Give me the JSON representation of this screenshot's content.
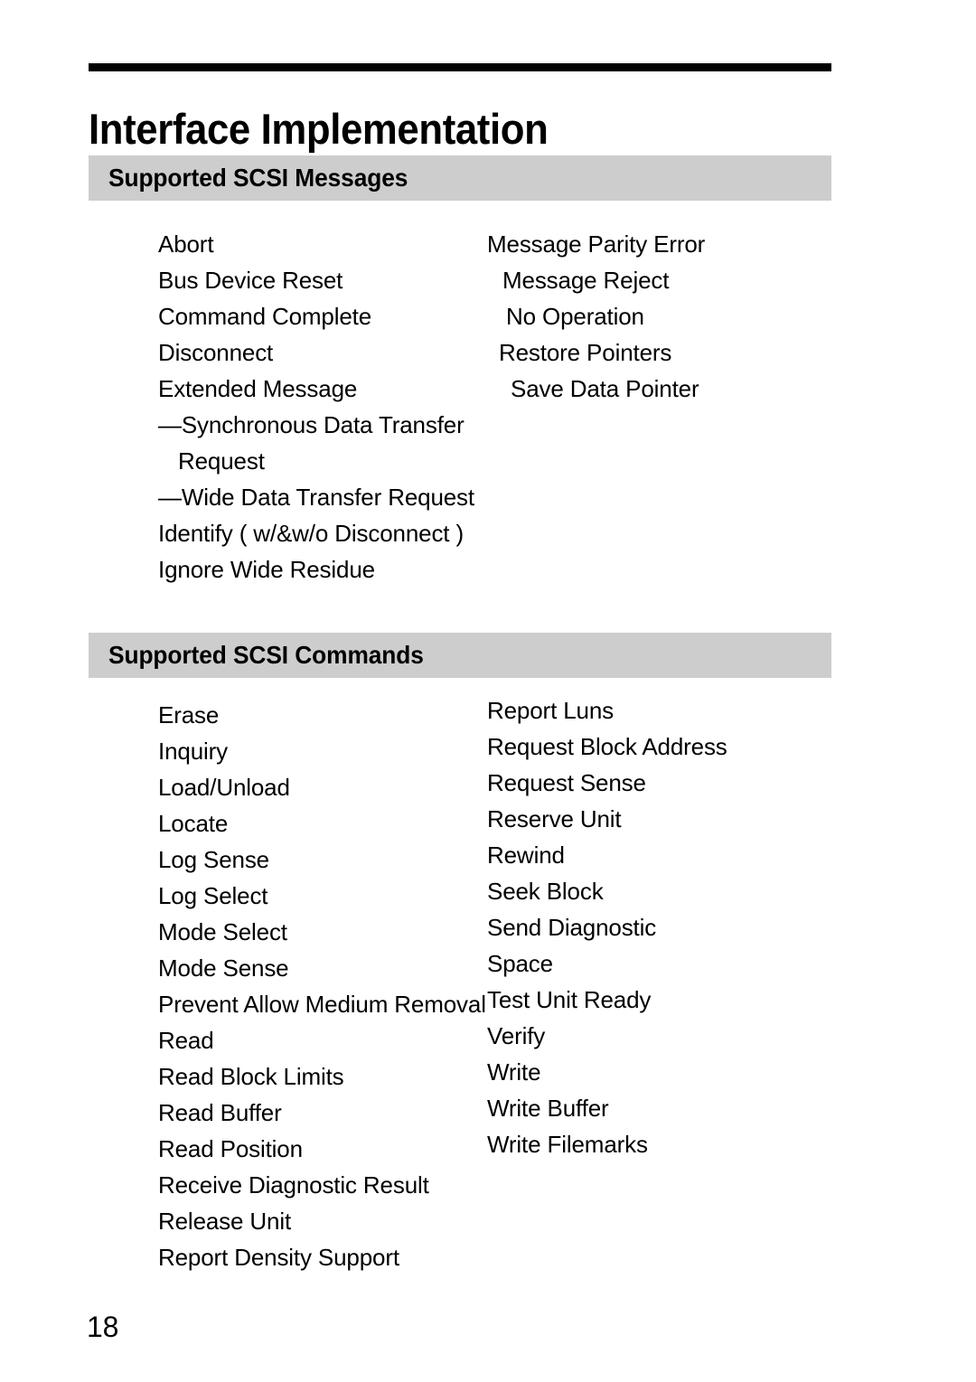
{
  "page": {
    "title": "Interface Implementation",
    "number": "18"
  },
  "sections": [
    {
      "id": "messages",
      "heading": "Supported SCSI Messages",
      "columns": [
        {
          "items": [
            {
              "text": "Abort",
              "indent": 0,
              "continuation": false
            },
            {
              "text": "Bus Device Reset",
              "indent": 0,
              "continuation": false
            },
            {
              "text": "Command Complete",
              "indent": 0,
              "continuation": false
            },
            {
              "text": "Disconnect",
              "indent": 0,
              "continuation": false
            },
            {
              "text": "Extended Message",
              "indent": 0,
              "continuation": false
            },
            {
              "text": "—Synchronous Data Transfer",
              "indent": 0,
              "continuation": false
            },
            {
              "text": "Request",
              "indent": 22,
              "continuation": true
            },
            {
              "text": "—Wide Data Transfer Request",
              "indent": 0,
              "continuation": false
            },
            {
              "text": "Identify ( w/&w/o Disconnect )",
              "indent": 0,
              "continuation": false
            },
            {
              "text": "Ignore Wide Residue",
              "indent": 0,
              "continuation": false
            }
          ]
        },
        {
          "items": [
            {
              "text": "Message Parity Error",
              "indent": 0,
              "continuation": false
            },
            {
              "text": "Message Reject",
              "indent": 17,
              "continuation": false
            },
            {
              "text": "No Operation",
              "indent": 21,
              "continuation": false
            },
            {
              "text": "Restore Pointers",
              "indent": 13,
              "continuation": false
            },
            {
              "text": "Save Data Pointer",
              "indent": 26,
              "continuation": false
            }
          ]
        }
      ]
    },
    {
      "id": "commands",
      "heading": "Supported SCSI Commands",
      "columns": [
        {
          "items": [
            {
              "text": "Erase",
              "indent": 0,
              "continuation": false
            },
            {
              "text": "Inquiry",
              "indent": 0,
              "continuation": false
            },
            {
              "text": "Load/Unload",
              "indent": 0,
              "continuation": false
            },
            {
              "text": "Locate",
              "indent": 0,
              "continuation": false
            },
            {
              "text": "Log Sense",
              "indent": 0,
              "continuation": false
            },
            {
              "text": "Log Select",
              "indent": 0,
              "continuation": false
            },
            {
              "text": "Mode Select",
              "indent": 0,
              "continuation": false
            },
            {
              "text": "Mode Sense",
              "indent": 0,
              "continuation": false
            },
            {
              "text": "Prevent Allow Medium Removal",
              "indent": 0,
              "continuation": false
            },
            {
              "text": "Read",
              "indent": 0,
              "continuation": false
            },
            {
              "text": "Read Block Limits",
              "indent": 0,
              "continuation": false
            },
            {
              "text": "Read Buffer",
              "indent": 0,
              "continuation": false
            },
            {
              "text": "Read Position",
              "indent": 0,
              "continuation": false
            },
            {
              "text": "Receive Diagnostic Result",
              "indent": 0,
              "continuation": false
            },
            {
              "text": "Release Unit",
              "indent": 0,
              "continuation": false
            },
            {
              "text": "Report Density Support",
              "indent": 0,
              "continuation": false
            }
          ]
        },
        {
          "items": [
            {
              "text": "Report Luns",
              "indent": 0,
              "continuation": false
            },
            {
              "text": "Request Block Address",
              "indent": 0,
              "continuation": false
            },
            {
              "text": "Request Sense",
              "indent": 0,
              "continuation": false
            },
            {
              "text": "Reserve Unit",
              "indent": 0,
              "continuation": false
            },
            {
              "text": "Rewind",
              "indent": 0,
              "continuation": false
            },
            {
              "text": "Seek Block",
              "indent": 0,
              "continuation": false
            },
            {
              "text": "Send Diagnostic",
              "indent": 0,
              "continuation": false
            },
            {
              "text": "Space",
              "indent": 0,
              "continuation": false
            },
            {
              "text": "Test Unit Ready",
              "indent": 0,
              "continuation": false
            },
            {
              "text": "Verify",
              "indent": 0,
              "continuation": false
            },
            {
              "text": "Write",
              "indent": 0,
              "continuation": false
            },
            {
              "text": "Write Buffer",
              "indent": 0,
              "continuation": false
            },
            {
              "text": "Write Filemarks",
              "indent": 0,
              "continuation": false
            }
          ]
        }
      ]
    }
  ],
  "colors": {
    "rule": "#000000",
    "section_bar": "#cdcdcd",
    "text": "#000000",
    "background": "#ffffff"
  }
}
